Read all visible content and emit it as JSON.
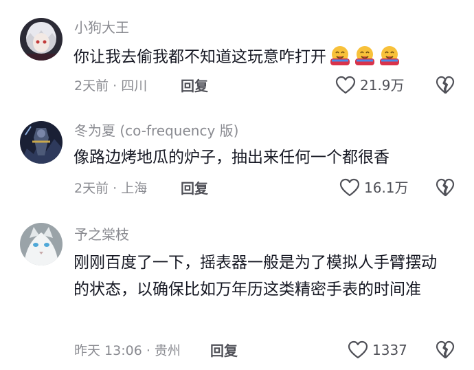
{
  "comments": [
    {
      "username": "小狗大王",
      "text": "你让我去偷我都不知道这玩意咋打开",
      "emoji_count": 3,
      "emoji_icon": "hugging-face-icon",
      "meta": "2天前 · 四川",
      "reply_label": "回复",
      "likes": "21.9万"
    },
    {
      "username": "冬为夏 (co-frequency 版)",
      "text": "像路边烤地瓜的炉子，抽出来任何一个都很香",
      "meta": "2天前 · 上海",
      "reply_label": "回复",
      "likes": "16.1万"
    },
    {
      "username": "予之棠枝",
      "text": "刚刚百度了一下，摇表器一般是为了模拟人手臂摆动的状态，以确保比如万年历这类精密手表的时间准",
      "meta": "昨天 13:06 · 贵州",
      "reply_label": "回复",
      "likes": "1337"
    }
  ],
  "icons": {
    "like": "heart-outline-icon",
    "dislike": "broken-heart-icon"
  }
}
